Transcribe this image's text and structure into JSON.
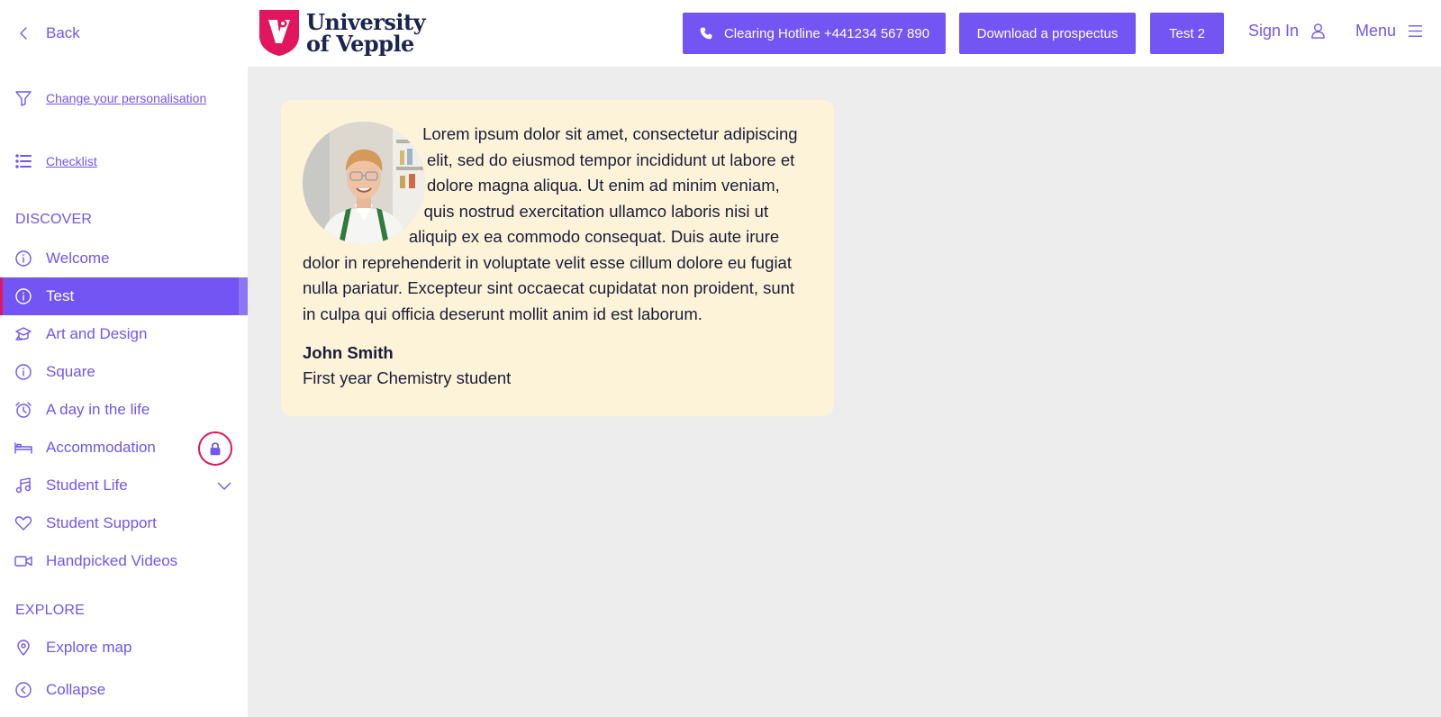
{
  "sidebar": {
    "back_label": "Back",
    "personalisation_label": "Change your personalisation",
    "checklist_label": "Checklist",
    "discover_heading": "DISCOVER",
    "items": [
      {
        "label": "Welcome",
        "icon": "info-icon"
      },
      {
        "label": "Test",
        "icon": "info-icon",
        "active": true
      },
      {
        "label": "Art and Design",
        "icon": "graduation-cap-icon"
      },
      {
        "label": "Square",
        "icon": "info-icon"
      },
      {
        "label": "A day in the life",
        "icon": "alarm-clock-icon"
      },
      {
        "label": "Accommodation",
        "icon": "bed-icon",
        "locked": true
      },
      {
        "label": "Student Life",
        "icon": "music-note-icon",
        "expandable": true
      },
      {
        "label": "Student Support",
        "icon": "heart-icon"
      },
      {
        "label": "Handpicked Videos",
        "icon": "video-camera-icon"
      }
    ],
    "explore_heading": "EXPLORE",
    "explore_map_label": "Explore map",
    "collapse_label": "Collapse"
  },
  "header": {
    "logo_line1": "University",
    "logo_line2": "of Vepple",
    "hotline_label": "Clearing Hotline +441234 567 890",
    "prospectus_label": "Download a prospectus",
    "test2_label": "Test 2",
    "signin_label": "Sign In",
    "menu_label": "Menu"
  },
  "testimonial": {
    "quote": "Lorem ipsum dolor sit amet, consectetur adipiscing elit, sed do eiusmod tempor incididunt ut labore et dolore magna aliqua. Ut enim ad minim veniam, quis nostrud exercitation ullamco laboris nisi ut aliquip ex ea commodo consequat. Duis aute irure dolor in reprehenderit in voluptate velit esse cillum dolore eu fugiat nulla pariatur. Excepteur sint occaecat cupidatat non proident, sunt in culpa qui officia deserunt mollit anim id est laborum.",
    "author": "John Smith",
    "role": "First year Chemistry student"
  },
  "colors": {
    "accent": "#7255f2",
    "highlight": "#e1165d",
    "card_bg": "#fcf3d8",
    "page_bg": "#ededed",
    "brand_navy": "#1a2550"
  }
}
